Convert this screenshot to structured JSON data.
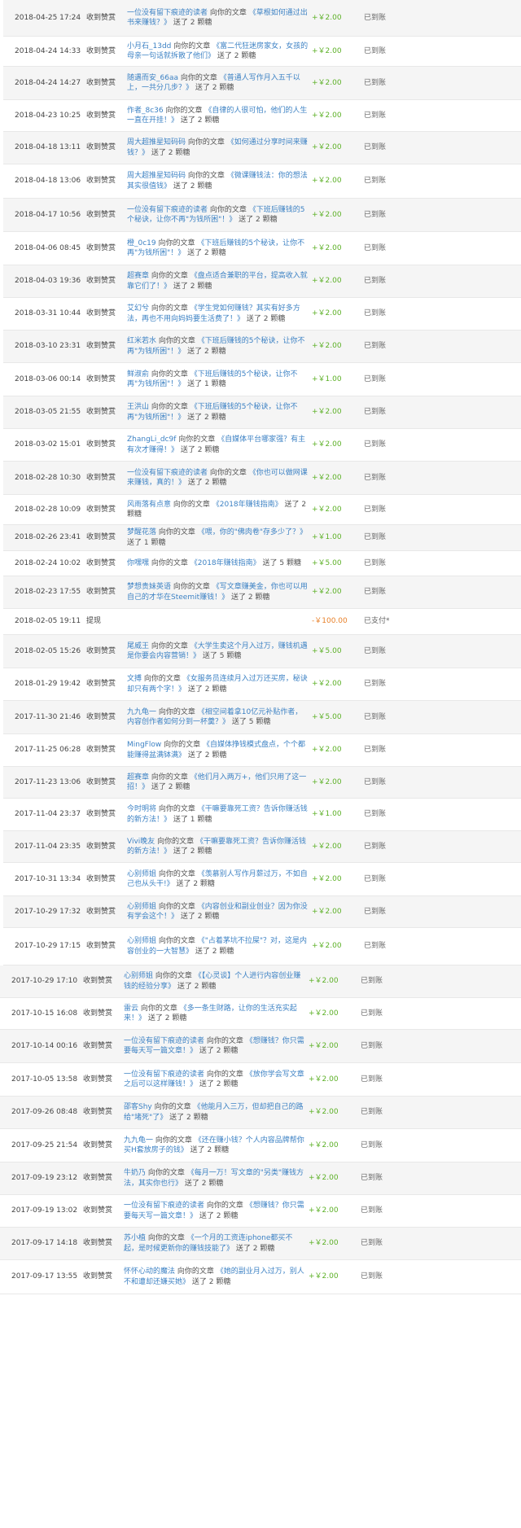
{
  "colors": {
    "income": "#5cb026",
    "withdraw": "#e8812a",
    "link": "#3d82c4",
    "row_alt": "#f5f5f5"
  },
  "rows": [
    {
      "date": "2018-04-25 17:24",
      "type": "收到赞赏",
      "user": "一位没有留下痕迹的读者",
      "pre": " 向你的文章 ",
      "title": "《草根如何通过出书来赚钱？》",
      "post": " 送了 2 颗糖",
      "amount": "+￥2.00",
      "status": "已到账"
    },
    {
      "date": "2018-04-24 14:33",
      "type": "收到赞赏",
      "user": "小月石_13dd",
      "pre": " 向你的文章 ",
      "title": "《富二代狂迷房家女，女孩的母亲一句话就拆散了他们》",
      "post": " 送了 2 颗糖",
      "amount": "+￥2.00",
      "status": "已到账"
    },
    {
      "date": "2018-04-24 14:27",
      "type": "收到赞赏",
      "user": "随遇而安_66aa",
      "pre": " 向你的文章 ",
      "title": "《普通人写作月入五千以上，一共分几步？》",
      "post": " 送了 2 颗糖",
      "amount": "+￥2.00",
      "status": "已到账"
    },
    {
      "date": "2018-04-23 10:25",
      "type": "收到赞赏",
      "user": "作者_8c36",
      "pre": " 向你的文章 ",
      "title": "《自律的人很可怕，他们的人生一直在开挂！》",
      "post": " 送了 2 颗糖",
      "amount": "+￥2.00",
      "status": "已到账"
    },
    {
      "date": "2018-04-18 13:11",
      "type": "收到赞赏",
      "user": "周大超推星知码码",
      "pre": " 向你的文章 ",
      "title": "《如何通过分享时间来赚钱？》",
      "post": " 送了 2 颗糖",
      "amount": "+￥2.00",
      "status": "已到账"
    },
    {
      "date": "2018-04-18 13:06",
      "type": "收到赞赏",
      "user": "周大超推星知码码",
      "pre": " 向你的文章 ",
      "title": "《微课赚钱法：你的想法其实很值钱》",
      "post": " 送了 2 颗糖",
      "amount": "+￥2.00",
      "status": "已到账"
    },
    {
      "date": "2018-04-17 10:56",
      "type": "收到赞赏",
      "user": "一位没有留下痕迹的读者",
      "pre": " 向你的文章 ",
      "title": "《下班后赚钱的5个秘诀，让你不再\"为钱所困\"！》",
      "post": " 送了 2 颗糖",
      "amount": "+￥2.00",
      "status": "已到账"
    },
    {
      "date": "2018-04-06 08:45",
      "type": "收到赞赏",
      "user": "橙_0c19",
      "pre": " 向你的文章 ",
      "title": "《下班后赚钱的5个秘诀，让你不再\"为钱所困\"！》",
      "post": " 送了 2 颗糖",
      "amount": "+￥2.00",
      "status": "已到账"
    },
    {
      "date": "2018-04-03 19:36",
      "type": "收到赞赏",
      "user": "超赛章",
      "pre": " 向你的文章 ",
      "title": "《盘点适合兼职的平台，提高收入就靠它们了！》",
      "post": " 送了 2 颗糖",
      "amount": "+￥2.00",
      "status": "已到账"
    },
    {
      "date": "2018-03-31 10:44",
      "type": "收到赞赏",
      "user": "艾幻兮",
      "pre": " 向你的文章 ",
      "title": "《学生党如何赚钱？其实有好多方法，再也不用向妈妈要生活费了！》",
      "post": " 送了 2 颗糖",
      "amount": "+￥2.00",
      "status": "已到账"
    },
    {
      "date": "2018-03-10 23:31",
      "type": "收到赞赏",
      "user": "红米若水",
      "pre": " 向你的文章 ",
      "title": "《下班后赚钱的5个秘诀，让你不再\"为钱所困\"！》",
      "post": " 送了 2 颗糖",
      "amount": "+￥2.00",
      "status": "已到账"
    },
    {
      "date": "2018-03-06 00:14",
      "type": "收到赞赏",
      "user": "鲜淑俞",
      "pre": " 向你的文章 ",
      "title": "《下班后赚钱的5个秘诀，让你不再\"为钱所困\"！》",
      "post": " 送了 1 颗糖",
      "amount": "+￥1.00",
      "status": "已到账"
    },
    {
      "date": "2018-03-05 21:55",
      "type": "收到赞赏",
      "user": "王洪山",
      "pre": " 向你的文章 ",
      "title": "《下班后赚钱的5个秘诀，让你不再\"为钱所困\"！》",
      "post": " 送了 2 颗糖",
      "amount": "+￥2.00",
      "status": "已到账"
    },
    {
      "date": "2018-03-02 15:01",
      "type": "收到赞赏",
      "user": "ZhangLi_dc9f",
      "pre": " 向你的文章 ",
      "title": "《自媒体平台哪家强？有主有次才赚得！》",
      "post": " 送了 2 颗糖",
      "amount": "+￥2.00",
      "status": "已到账"
    },
    {
      "date": "2018-02-28 10:30",
      "type": "收到赞赏",
      "user": "一位没有留下痕迹的读者",
      "pre": " 向你的文章 ",
      "title": "《你也可以做网课来赚钱，真的！》",
      "post": " 送了 2 颗糖",
      "amount": "+￥2.00",
      "status": "已到账"
    },
    {
      "date": "2018-02-28 10:09",
      "type": "收到赞赏",
      "user": "风雨落有点意",
      "pre": " 向你的文章 ",
      "title": "《2018年赚钱指南》",
      "post": " 送了 2 颗糖",
      "amount": "+￥2.00",
      "status": "已到账"
    },
    {
      "date": "2018-02-26 23:41",
      "type": "收到赞赏",
      "user": "梦醒花落",
      "pre": " 向你的文章 ",
      "title": "《喂，你的\"佛肉卷\"存多少了？》",
      "post": " 送了 1 颗糖",
      "amount": "+￥1.00",
      "status": "已到账"
    },
    {
      "date": "2018-02-24 10:02",
      "type": "收到赞赏",
      "user": "你嘿嘿",
      "pre": " 向你的文章 ",
      "title": "《2018年赚钱指南》",
      "post": " 送了 5 颗糖",
      "amount": "+￥5.00",
      "status": "已到账"
    },
    {
      "date": "2018-02-23 17:55",
      "type": "收到赞赏",
      "user": "梦想贵妹英语",
      "pre": " 向你的文章 ",
      "title": "《写文章赚美金，你也可以用自己的才华在Steemit赚钱！》",
      "post": " 送了 2 颗糖",
      "amount": "+￥2.00",
      "status": "已到账"
    },
    {
      "date": "2018-02-05 19:11",
      "type": "提现",
      "user": "",
      "pre": "",
      "title": "",
      "post": "",
      "amount": "-￥100.00",
      "status": "已支付*",
      "withdraw": true
    },
    {
      "date": "2018-02-05 15:26",
      "type": "收到赞赏",
      "user": "尾威王",
      "pre": " 向你的文章 ",
      "title": "《大学生卖这个月入过万，赚钱机遇是你要会内容营销！》",
      "post": " 送了 5 颗糖",
      "amount": "+￥5.00",
      "status": "已到账"
    },
    {
      "date": "2018-01-29 19:42",
      "type": "收到赞赏",
      "user": "文搏",
      "pre": " 向你的文章 ",
      "title": "《女服务员连续月入过万还买房，秘诀却只有两个字！》",
      "post": " 送了 2 颗糖",
      "amount": "+￥2.00",
      "status": "已到账"
    },
    {
      "date": "2017-11-30 21:46",
      "type": "收到赞赏",
      "user": "九九龟一",
      "pre": " 向你的文章 ",
      "title": "《相空间着拿10亿元补贴作者，内容创作者如何分到一杯羹？》",
      "post": " 送了 5 颗糖",
      "amount": "+￥5.00",
      "status": "已到账"
    },
    {
      "date": "2017-11-25 06:28",
      "type": "收到赞赏",
      "user": "MingFlow",
      "pre": " 向你的文章 ",
      "title": "《自媒体挣钱模式盘点，个个都能赚得盆满钵满》",
      "post": " 送了 2 颗糖",
      "amount": "+￥2.00",
      "status": "已到账"
    },
    {
      "date": "2017-11-23 13:06",
      "type": "收到赞赏",
      "user": "超赛章",
      "pre": " 向你的文章 ",
      "title": "《他们月入两万+，他们只用了这一招！》",
      "post": " 送了 2 颗糖",
      "amount": "+￥2.00",
      "status": "已到账"
    },
    {
      "date": "2017-11-04 23:37",
      "type": "收到赞赏",
      "user": "今时明将",
      "pre": " 向你的文章 ",
      "title": "《干嘛要靠死工资？告诉你赚活钱的新方法！》",
      "post": " 送了 1 颗糖",
      "amount": "+￥1.00",
      "status": "已到账"
    },
    {
      "date": "2017-11-04 23:35",
      "type": "收到赞赏",
      "user": "Vivi晚友",
      "pre": " 向你的文章 ",
      "title": "《干嘛要靠死工资？告诉你赚活钱的新方法！》",
      "post": " 送了 2 颗糖",
      "amount": "+￥2.00",
      "status": "已到账"
    },
    {
      "date": "2017-10-31 13:34",
      "type": "收到赞赏",
      "user": "心别师姐",
      "pre": " 向你的文章 ",
      "title": "《羡慕别人写作月薪过万，不如自己也从头干!》",
      "post": " 送了 2 颗糖",
      "amount": "+￥2.00",
      "status": "已到账"
    },
    {
      "date": "2017-10-29 17:32",
      "type": "收到赞赏",
      "user": "心别师姐",
      "pre": " 向你的文章 ",
      "title": "《内容创业和副业创业？因为你没有学会这个！》",
      "post": " 送了 2 颗糖",
      "amount": "+￥2.00",
      "status": "已到账"
    },
    {
      "date": "2017-10-29 17:15",
      "type": "收到赞赏",
      "user": "心别师姐",
      "pre": " 向你的文章 ",
      "title": "《\"占着茅坑不拉屎\"？对，这是内容创业的一大智慧》",
      "post": " 送了 2 颗糖",
      "amount": "+￥2.00",
      "status": "已到账"
    },
    {
      "date": "2017-10-29 17:10",
      "type": "收到赞赏",
      "user": "心别师姐",
      "pre": " 向你的文章 ",
      "title": "《【心灵谈】个人进行内容创业赚钱的经验分享》",
      "post": " 送了 2 颗糖",
      "amount": "+￥2.00",
      "status": "已到账",
      "shift": true
    },
    {
      "date": "2017-10-15 16:08",
      "type": "收到赞赏",
      "user": "雷云",
      "pre": " 向你的文章 ",
      "title": "《多一条生财路，让你的生活充实起来！》",
      "post": " 送了 2 颗糖",
      "amount": "+￥2.00",
      "status": "已到账",
      "shift": true
    },
    {
      "date": "2017-10-14 00:16",
      "type": "收到赞赏",
      "user": "一位没有留下痕迹的读者",
      "pre": " 向你的文章 ",
      "title": "《想赚钱？你只需要每天写一篇文章！》",
      "post": " 送了 2 颗糖",
      "amount": "+￥2.00",
      "status": "已到账",
      "shift": true
    },
    {
      "date": "2017-10-05 13:58",
      "type": "收到赞赏",
      "user": "一位没有留下痕迹的读者",
      "pre": " 向你的文章 ",
      "title": "《放你学会写文章之后可以这样赚钱！》",
      "post": " 送了 2 颗糖",
      "amount": "+￥2.00",
      "status": "已到账",
      "shift": true
    },
    {
      "date": "2017-09-26 08:48",
      "type": "收到赞赏",
      "user": "邵客Shy",
      "pre": " 向你的文章 ",
      "title": "《他能月入三万，但却把自己的路给\"堵死\"了》",
      "post": " 送了 2 颗糖",
      "amount": "+￥2.00",
      "status": "已到账",
      "shift": true
    },
    {
      "date": "2017-09-25 21:54",
      "type": "收到赞赏",
      "user": "九九龟一",
      "pre": " 向你的文章 ",
      "title": "《还在赚小钱？个人内容品牌帮你买H套放房子的钱》",
      "post": " 送了 2 颗糖",
      "amount": "+￥2.00",
      "status": "已到账",
      "shift": true
    },
    {
      "date": "2017-09-19 23:12",
      "type": "收到赞赏",
      "user": "牛奶乃",
      "pre": " 向你的文章 ",
      "title": "《每月一万！写文章的\"另类\"赚钱方法，其实你也行》",
      "post": " 送了 2 颗糖",
      "amount": "+￥2.00",
      "status": "已到账",
      "shift": true
    },
    {
      "date": "2017-09-19 13:02",
      "type": "收到赞赏",
      "user": "一位没有留下痕迹的读者",
      "pre": " 向你的文章 ",
      "title": "《想赚钱？你只需要每天写一篇文章！》",
      "post": " 送了 2 颗糖",
      "amount": "+￥2.00",
      "status": "已到账",
      "shift": true
    },
    {
      "date": "2017-09-17 14:18",
      "type": "收到赞赏",
      "user": "苏小植",
      "pre": " 向你的文章 ",
      "title": "《一个月的工资连iphone都买不起，是时候更新你的赚钱技能了》",
      "post": " 送了 2 颗糖",
      "amount": "+￥2.00",
      "status": "已到账",
      "shift": true
    },
    {
      "date": "2017-09-17 13:55",
      "type": "收到赞赏",
      "user": "怀怀心动的魔法",
      "pre": " 向你的文章 ",
      "title": "《她的副业月入过万，别人不和遭却还嫌买她》",
      "post": " 送了 2 颗糖",
      "amount": "+￥2.00",
      "status": "已到账",
      "shift": true
    }
  ]
}
